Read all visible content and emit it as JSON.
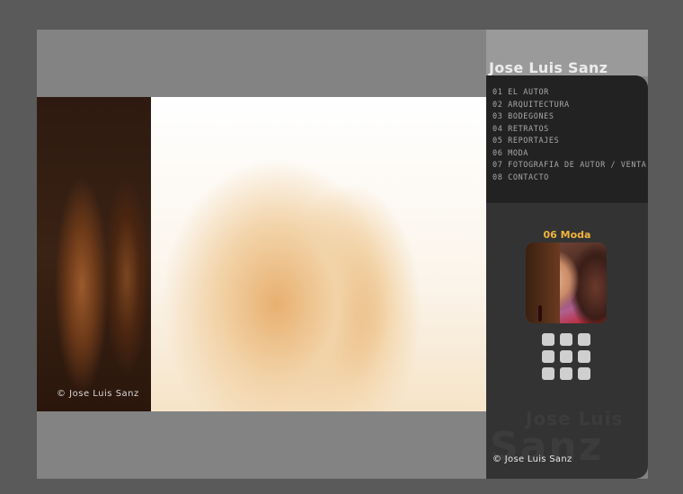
{
  "header": {
    "site_title": "Jose Luis Sanz"
  },
  "menu": {
    "items": [
      {
        "label": "01 EL AUTOR"
      },
      {
        "label": "02 ARQUITECTURA"
      },
      {
        "label": "03 BODEGONES"
      },
      {
        "label": "04 RETRATOS"
      },
      {
        "label": "05 REPORTAJES"
      },
      {
        "label": "06 MODA"
      },
      {
        "label": "07 FOTOGRAFIA DE AUTOR / VENTA"
      },
      {
        "label": "08 CONTACTO"
      }
    ]
  },
  "main": {
    "photo_copyright": "© Jose Luis Sanz"
  },
  "sidebar": {
    "section_title": "06 Moda",
    "grid_icon": "grid-icon",
    "watermark_line1": "Jose Luis",
    "watermark_line2": "Sanz",
    "footer_copyright": "© Jose Luis Sanz"
  },
  "colors": {
    "background": "#5a5a5a",
    "frame": "#838383",
    "menu_panel": "#222222",
    "lower_panel": "#333333",
    "accent": "#f0b43c"
  }
}
